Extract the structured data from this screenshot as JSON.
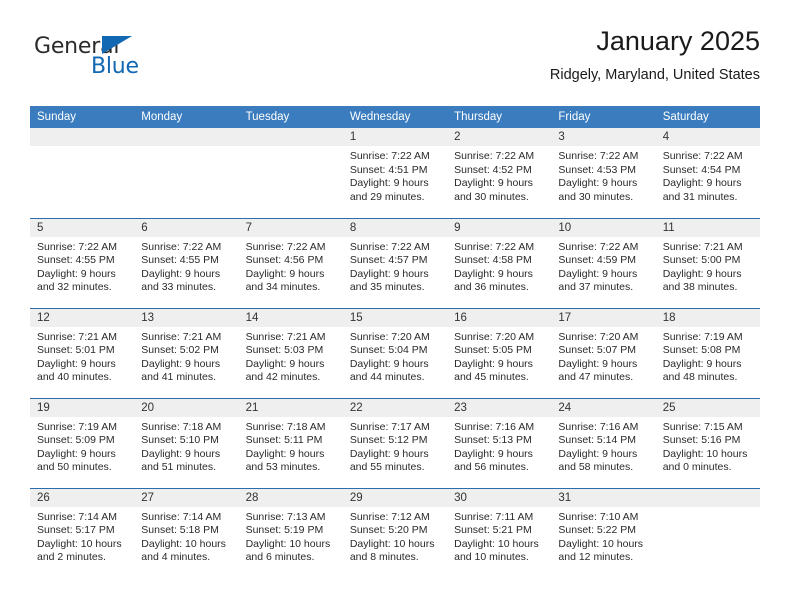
{
  "logo": {
    "word1": "General",
    "word2": "Blue",
    "triangle_color": "#1268b3"
  },
  "header": {
    "title": "January 2025",
    "subtitle": "Ridgely, Maryland, United States"
  },
  "theme": {
    "header_row_bg": "#3a7cbe",
    "week_separator": "#2a6ead",
    "daynum_band_bg": "#efefef",
    "text_color": "#2a2a2a"
  },
  "weekdays": [
    "Sunday",
    "Monday",
    "Tuesday",
    "Wednesday",
    "Thursday",
    "Friday",
    "Saturday"
  ],
  "labels": {
    "sunrise_prefix": "Sunrise:",
    "sunset_prefix": "Sunset:",
    "daylight_prefix": "Daylight:"
  },
  "weeks": [
    [
      {
        "day": "",
        "sunrise": "",
        "sunset": "",
        "daylight_l1": "",
        "daylight_l2": ""
      },
      {
        "day": "",
        "sunrise": "",
        "sunset": "",
        "daylight_l1": "",
        "daylight_l2": ""
      },
      {
        "day": "",
        "sunrise": "",
        "sunset": "",
        "daylight_l1": "",
        "daylight_l2": ""
      },
      {
        "day": "1",
        "sunrise": "Sunrise: 7:22 AM",
        "sunset": "Sunset: 4:51 PM",
        "daylight_l1": "Daylight: 9 hours",
        "daylight_l2": "and 29 minutes."
      },
      {
        "day": "2",
        "sunrise": "Sunrise: 7:22 AM",
        "sunset": "Sunset: 4:52 PM",
        "daylight_l1": "Daylight: 9 hours",
        "daylight_l2": "and 30 minutes."
      },
      {
        "day": "3",
        "sunrise": "Sunrise: 7:22 AM",
        "sunset": "Sunset: 4:53 PM",
        "daylight_l1": "Daylight: 9 hours",
        "daylight_l2": "and 30 minutes."
      },
      {
        "day": "4",
        "sunrise": "Sunrise: 7:22 AM",
        "sunset": "Sunset: 4:54 PM",
        "daylight_l1": "Daylight: 9 hours",
        "daylight_l2": "and 31 minutes."
      }
    ],
    [
      {
        "day": "5",
        "sunrise": "Sunrise: 7:22 AM",
        "sunset": "Sunset: 4:55 PM",
        "daylight_l1": "Daylight: 9 hours",
        "daylight_l2": "and 32 minutes."
      },
      {
        "day": "6",
        "sunrise": "Sunrise: 7:22 AM",
        "sunset": "Sunset: 4:55 PM",
        "daylight_l1": "Daylight: 9 hours",
        "daylight_l2": "and 33 minutes."
      },
      {
        "day": "7",
        "sunrise": "Sunrise: 7:22 AM",
        "sunset": "Sunset: 4:56 PM",
        "daylight_l1": "Daylight: 9 hours",
        "daylight_l2": "and 34 minutes."
      },
      {
        "day": "8",
        "sunrise": "Sunrise: 7:22 AM",
        "sunset": "Sunset: 4:57 PM",
        "daylight_l1": "Daylight: 9 hours",
        "daylight_l2": "and 35 minutes."
      },
      {
        "day": "9",
        "sunrise": "Sunrise: 7:22 AM",
        "sunset": "Sunset: 4:58 PM",
        "daylight_l1": "Daylight: 9 hours",
        "daylight_l2": "and 36 minutes."
      },
      {
        "day": "10",
        "sunrise": "Sunrise: 7:22 AM",
        "sunset": "Sunset: 4:59 PM",
        "daylight_l1": "Daylight: 9 hours",
        "daylight_l2": "and 37 minutes."
      },
      {
        "day": "11",
        "sunrise": "Sunrise: 7:21 AM",
        "sunset": "Sunset: 5:00 PM",
        "daylight_l1": "Daylight: 9 hours",
        "daylight_l2": "and 38 minutes."
      }
    ],
    [
      {
        "day": "12",
        "sunrise": "Sunrise: 7:21 AM",
        "sunset": "Sunset: 5:01 PM",
        "daylight_l1": "Daylight: 9 hours",
        "daylight_l2": "and 40 minutes."
      },
      {
        "day": "13",
        "sunrise": "Sunrise: 7:21 AM",
        "sunset": "Sunset: 5:02 PM",
        "daylight_l1": "Daylight: 9 hours",
        "daylight_l2": "and 41 minutes."
      },
      {
        "day": "14",
        "sunrise": "Sunrise: 7:21 AM",
        "sunset": "Sunset: 5:03 PM",
        "daylight_l1": "Daylight: 9 hours",
        "daylight_l2": "and 42 minutes."
      },
      {
        "day": "15",
        "sunrise": "Sunrise: 7:20 AM",
        "sunset": "Sunset: 5:04 PM",
        "daylight_l1": "Daylight: 9 hours",
        "daylight_l2": "and 44 minutes."
      },
      {
        "day": "16",
        "sunrise": "Sunrise: 7:20 AM",
        "sunset": "Sunset: 5:05 PM",
        "daylight_l1": "Daylight: 9 hours",
        "daylight_l2": "and 45 minutes."
      },
      {
        "day": "17",
        "sunrise": "Sunrise: 7:20 AM",
        "sunset": "Sunset: 5:07 PM",
        "daylight_l1": "Daylight: 9 hours",
        "daylight_l2": "and 47 minutes."
      },
      {
        "day": "18",
        "sunrise": "Sunrise: 7:19 AM",
        "sunset": "Sunset: 5:08 PM",
        "daylight_l1": "Daylight: 9 hours",
        "daylight_l2": "and 48 minutes."
      }
    ],
    [
      {
        "day": "19",
        "sunrise": "Sunrise: 7:19 AM",
        "sunset": "Sunset: 5:09 PM",
        "daylight_l1": "Daylight: 9 hours",
        "daylight_l2": "and 50 minutes."
      },
      {
        "day": "20",
        "sunrise": "Sunrise: 7:18 AM",
        "sunset": "Sunset: 5:10 PM",
        "daylight_l1": "Daylight: 9 hours",
        "daylight_l2": "and 51 minutes."
      },
      {
        "day": "21",
        "sunrise": "Sunrise: 7:18 AM",
        "sunset": "Sunset: 5:11 PM",
        "daylight_l1": "Daylight: 9 hours",
        "daylight_l2": "and 53 minutes."
      },
      {
        "day": "22",
        "sunrise": "Sunrise: 7:17 AM",
        "sunset": "Sunset: 5:12 PM",
        "daylight_l1": "Daylight: 9 hours",
        "daylight_l2": "and 55 minutes."
      },
      {
        "day": "23",
        "sunrise": "Sunrise: 7:16 AM",
        "sunset": "Sunset: 5:13 PM",
        "daylight_l1": "Daylight: 9 hours",
        "daylight_l2": "and 56 minutes."
      },
      {
        "day": "24",
        "sunrise": "Sunrise: 7:16 AM",
        "sunset": "Sunset: 5:14 PM",
        "daylight_l1": "Daylight: 9 hours",
        "daylight_l2": "and 58 minutes."
      },
      {
        "day": "25",
        "sunrise": "Sunrise: 7:15 AM",
        "sunset": "Sunset: 5:16 PM",
        "daylight_l1": "Daylight: 10 hours",
        "daylight_l2": "and 0 minutes."
      }
    ],
    [
      {
        "day": "26",
        "sunrise": "Sunrise: 7:14 AM",
        "sunset": "Sunset: 5:17 PM",
        "daylight_l1": "Daylight: 10 hours",
        "daylight_l2": "and 2 minutes."
      },
      {
        "day": "27",
        "sunrise": "Sunrise: 7:14 AM",
        "sunset": "Sunset: 5:18 PM",
        "daylight_l1": "Daylight: 10 hours",
        "daylight_l2": "and 4 minutes."
      },
      {
        "day": "28",
        "sunrise": "Sunrise: 7:13 AM",
        "sunset": "Sunset: 5:19 PM",
        "daylight_l1": "Daylight: 10 hours",
        "daylight_l2": "and 6 minutes."
      },
      {
        "day": "29",
        "sunrise": "Sunrise: 7:12 AM",
        "sunset": "Sunset: 5:20 PM",
        "daylight_l1": "Daylight: 10 hours",
        "daylight_l2": "and 8 minutes."
      },
      {
        "day": "30",
        "sunrise": "Sunrise: 7:11 AM",
        "sunset": "Sunset: 5:21 PM",
        "daylight_l1": "Daylight: 10 hours",
        "daylight_l2": "and 10 minutes."
      },
      {
        "day": "31",
        "sunrise": "Sunrise: 7:10 AM",
        "sunset": "Sunset: 5:22 PM",
        "daylight_l1": "Daylight: 10 hours",
        "daylight_l2": "and 12 minutes."
      },
      {
        "day": "",
        "sunrise": "",
        "sunset": "",
        "daylight_l1": "",
        "daylight_l2": ""
      }
    ]
  ]
}
